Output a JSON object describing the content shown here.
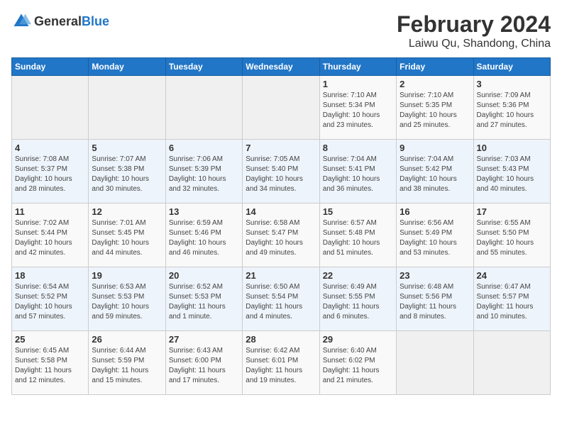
{
  "logo": {
    "general": "General",
    "blue": "Blue"
  },
  "title": "February 2024",
  "subtitle": "Laiwu Qu, Shandong, China",
  "days_of_week": [
    "Sunday",
    "Monday",
    "Tuesday",
    "Wednesday",
    "Thursday",
    "Friday",
    "Saturday"
  ],
  "weeks": [
    [
      {
        "day": "",
        "info": ""
      },
      {
        "day": "",
        "info": ""
      },
      {
        "day": "",
        "info": ""
      },
      {
        "day": "",
        "info": ""
      },
      {
        "day": "1",
        "info": "Sunrise: 7:10 AM\nSunset: 5:34 PM\nDaylight: 10 hours\nand 23 minutes."
      },
      {
        "day": "2",
        "info": "Sunrise: 7:10 AM\nSunset: 5:35 PM\nDaylight: 10 hours\nand 25 minutes."
      },
      {
        "day": "3",
        "info": "Sunrise: 7:09 AM\nSunset: 5:36 PM\nDaylight: 10 hours\nand 27 minutes."
      }
    ],
    [
      {
        "day": "4",
        "info": "Sunrise: 7:08 AM\nSunset: 5:37 PM\nDaylight: 10 hours\nand 28 minutes."
      },
      {
        "day": "5",
        "info": "Sunrise: 7:07 AM\nSunset: 5:38 PM\nDaylight: 10 hours\nand 30 minutes."
      },
      {
        "day": "6",
        "info": "Sunrise: 7:06 AM\nSunset: 5:39 PM\nDaylight: 10 hours\nand 32 minutes."
      },
      {
        "day": "7",
        "info": "Sunrise: 7:05 AM\nSunset: 5:40 PM\nDaylight: 10 hours\nand 34 minutes."
      },
      {
        "day": "8",
        "info": "Sunrise: 7:04 AM\nSunset: 5:41 PM\nDaylight: 10 hours\nand 36 minutes."
      },
      {
        "day": "9",
        "info": "Sunrise: 7:04 AM\nSunset: 5:42 PM\nDaylight: 10 hours\nand 38 minutes."
      },
      {
        "day": "10",
        "info": "Sunrise: 7:03 AM\nSunset: 5:43 PM\nDaylight: 10 hours\nand 40 minutes."
      }
    ],
    [
      {
        "day": "11",
        "info": "Sunrise: 7:02 AM\nSunset: 5:44 PM\nDaylight: 10 hours\nand 42 minutes."
      },
      {
        "day": "12",
        "info": "Sunrise: 7:01 AM\nSunset: 5:45 PM\nDaylight: 10 hours\nand 44 minutes."
      },
      {
        "day": "13",
        "info": "Sunrise: 6:59 AM\nSunset: 5:46 PM\nDaylight: 10 hours\nand 46 minutes."
      },
      {
        "day": "14",
        "info": "Sunrise: 6:58 AM\nSunset: 5:47 PM\nDaylight: 10 hours\nand 49 minutes."
      },
      {
        "day": "15",
        "info": "Sunrise: 6:57 AM\nSunset: 5:48 PM\nDaylight: 10 hours\nand 51 minutes."
      },
      {
        "day": "16",
        "info": "Sunrise: 6:56 AM\nSunset: 5:49 PM\nDaylight: 10 hours\nand 53 minutes."
      },
      {
        "day": "17",
        "info": "Sunrise: 6:55 AM\nSunset: 5:50 PM\nDaylight: 10 hours\nand 55 minutes."
      }
    ],
    [
      {
        "day": "18",
        "info": "Sunrise: 6:54 AM\nSunset: 5:52 PM\nDaylight: 10 hours\nand 57 minutes."
      },
      {
        "day": "19",
        "info": "Sunrise: 6:53 AM\nSunset: 5:53 PM\nDaylight: 10 hours\nand 59 minutes."
      },
      {
        "day": "20",
        "info": "Sunrise: 6:52 AM\nSunset: 5:53 PM\nDaylight: 11 hours\nand 1 minute."
      },
      {
        "day": "21",
        "info": "Sunrise: 6:50 AM\nSunset: 5:54 PM\nDaylight: 11 hours\nand 4 minutes."
      },
      {
        "day": "22",
        "info": "Sunrise: 6:49 AM\nSunset: 5:55 PM\nDaylight: 11 hours\nand 6 minutes."
      },
      {
        "day": "23",
        "info": "Sunrise: 6:48 AM\nSunset: 5:56 PM\nDaylight: 11 hours\nand 8 minutes."
      },
      {
        "day": "24",
        "info": "Sunrise: 6:47 AM\nSunset: 5:57 PM\nDaylight: 11 hours\nand 10 minutes."
      }
    ],
    [
      {
        "day": "25",
        "info": "Sunrise: 6:45 AM\nSunset: 5:58 PM\nDaylight: 11 hours\nand 12 minutes."
      },
      {
        "day": "26",
        "info": "Sunrise: 6:44 AM\nSunset: 5:59 PM\nDaylight: 11 hours\nand 15 minutes."
      },
      {
        "day": "27",
        "info": "Sunrise: 6:43 AM\nSunset: 6:00 PM\nDaylight: 11 hours\nand 17 minutes."
      },
      {
        "day": "28",
        "info": "Sunrise: 6:42 AM\nSunset: 6:01 PM\nDaylight: 11 hours\nand 19 minutes."
      },
      {
        "day": "29",
        "info": "Sunrise: 6:40 AM\nSunset: 6:02 PM\nDaylight: 11 hours\nand 21 minutes."
      },
      {
        "day": "",
        "info": ""
      },
      {
        "day": "",
        "info": ""
      }
    ]
  ]
}
